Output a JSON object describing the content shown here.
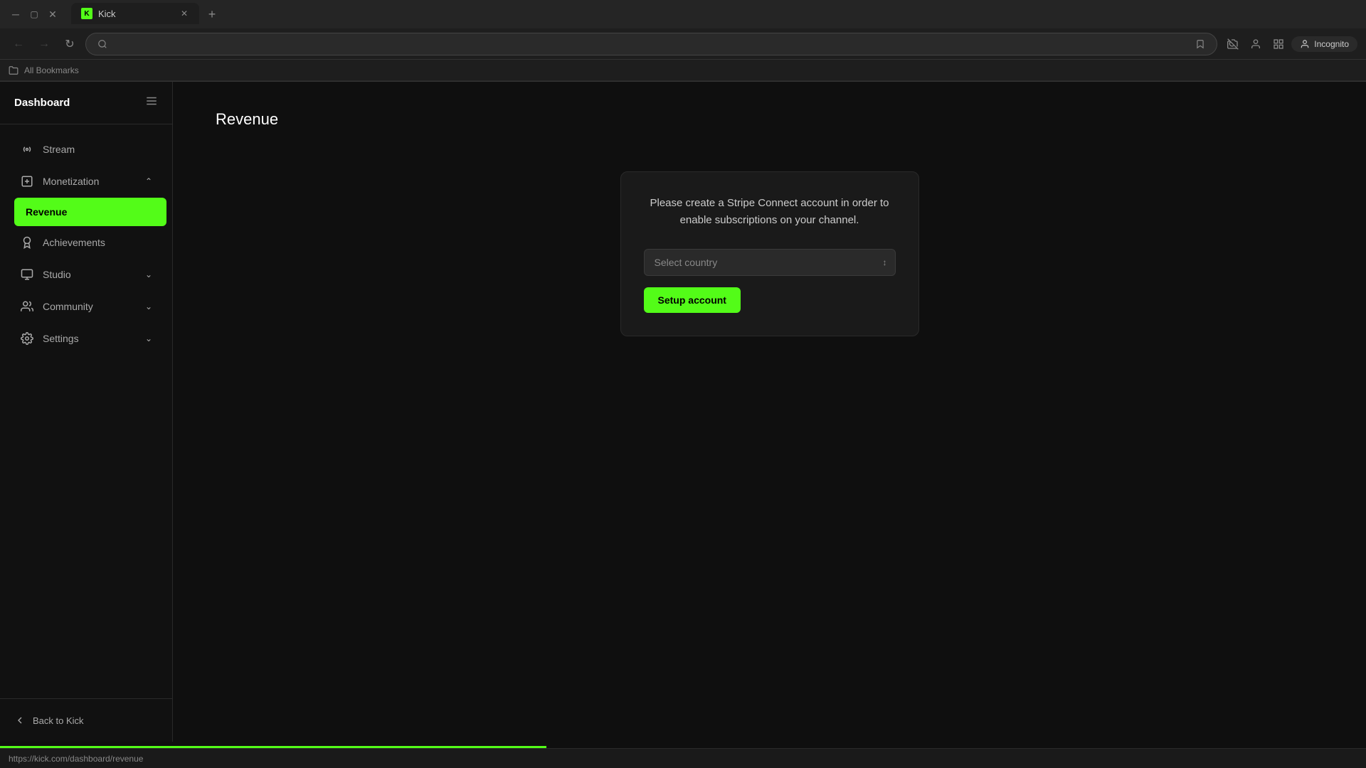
{
  "browser": {
    "tab_title": "Kick",
    "tab_favicon_letter": "K",
    "url": "kick.com/dashboard/revenue",
    "full_url": "https://kick.com/dashboard/revenue",
    "incognito_label": "Incognito",
    "bookmarks_label": "All Bookmarks"
  },
  "sidebar": {
    "title": "Dashboard",
    "toggle_icon": "≡",
    "items": [
      {
        "id": "stream",
        "label": "Stream",
        "icon": "stream",
        "expandable": false,
        "active": false
      },
      {
        "id": "monetization",
        "label": "Monetization",
        "icon": "monetization",
        "expandable": true,
        "active": false,
        "expanded": true
      },
      {
        "id": "revenue",
        "label": "Revenue",
        "icon": null,
        "active": true,
        "sub": true
      },
      {
        "id": "achievements",
        "label": "Achievements",
        "icon": "achievements",
        "expandable": false,
        "active": false
      },
      {
        "id": "studio",
        "label": "Studio",
        "icon": "studio",
        "expandable": true,
        "active": false
      },
      {
        "id": "community",
        "label": "Community",
        "icon": "community",
        "expandable": true,
        "active": false
      },
      {
        "id": "settings",
        "label": "Settings",
        "icon": "settings",
        "expandable": true,
        "active": false
      }
    ],
    "footer": {
      "back_label": "Back to Kick",
      "back_icon": "←"
    }
  },
  "main": {
    "page_title": "Revenue",
    "card": {
      "description_line1": "Please create a Stripe Connect account in order to",
      "description_line2": "enable subscriptions on your channel.",
      "select_placeholder": "Select country",
      "setup_button_label": "Setup account"
    }
  },
  "status_bar": {
    "url": "https://kick.com/dashboard/revenue"
  }
}
